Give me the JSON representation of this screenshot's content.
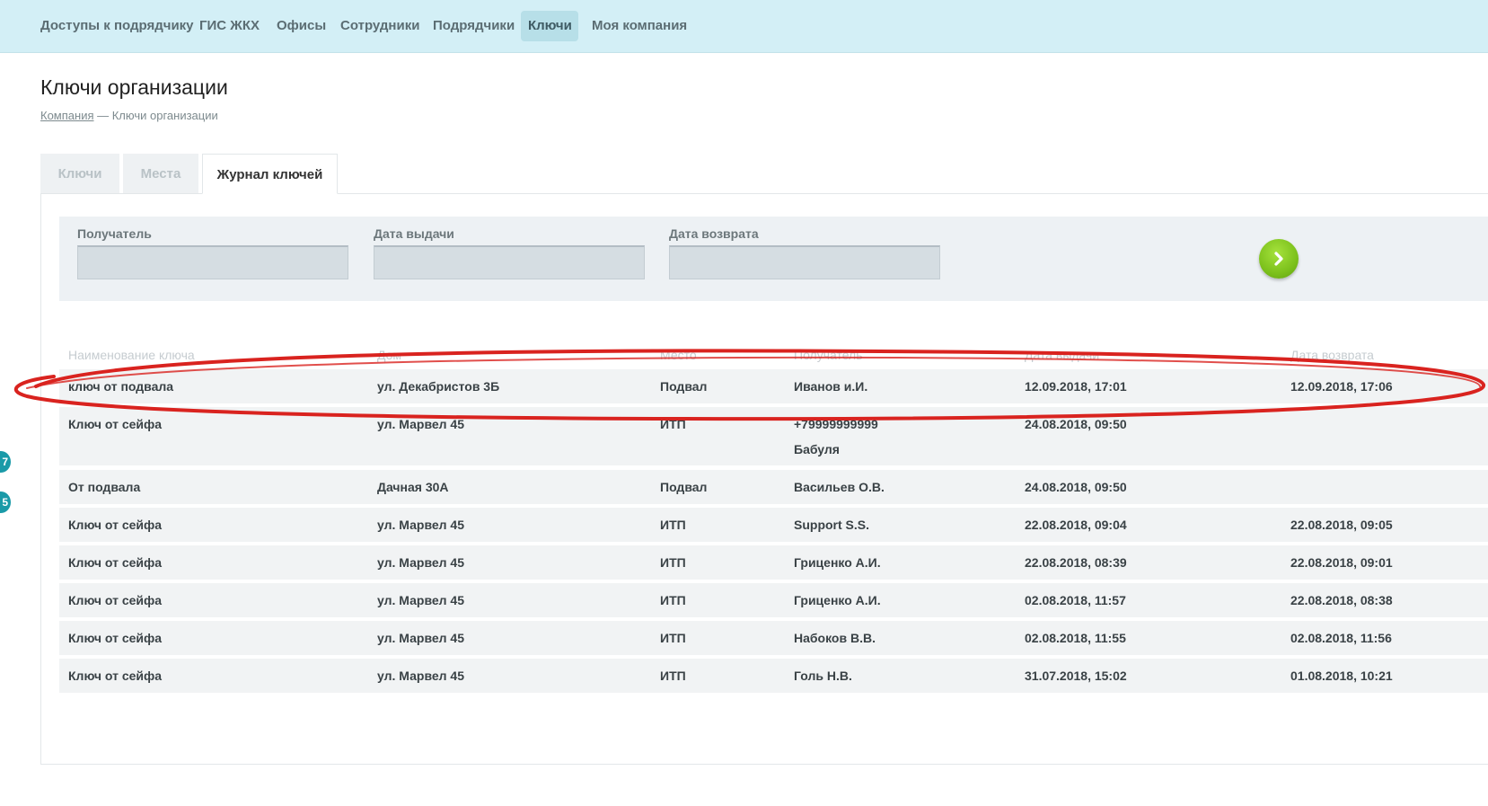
{
  "nav": {
    "items": [
      {
        "label": "Доступы к подрядчику"
      },
      {
        "label": "ГИС ЖКХ"
      },
      {
        "label": "Офисы"
      },
      {
        "label": "Сотрудники"
      },
      {
        "label": "Подрядчики"
      },
      {
        "label": "Ключи",
        "active": true
      },
      {
        "label": "Моя компания"
      }
    ]
  },
  "page": {
    "title": "Ключи организации",
    "breadcrumb": {
      "link": "Компания",
      "separator": " — ",
      "current": "Ключи организации"
    }
  },
  "tabs": [
    {
      "label": "Ключи"
    },
    {
      "label": "Места"
    },
    {
      "label": "Журнал ключей",
      "active": true
    }
  ],
  "filters": {
    "recipient_label": "Получатель",
    "issue_date_label": "Дата выдачи",
    "return_date_label": "Дата возврата",
    "recipient_value": "",
    "issue_date_value": "",
    "return_date_value": "",
    "submit_icon": "chevron-right-icon"
  },
  "table": {
    "headers": [
      "Наименование ключа",
      "Дом",
      "Место",
      "Получатель",
      "Дата выдачи",
      "Дата возврата"
    ],
    "rows": [
      {
        "name": "ключ от подвала",
        "house": "ул. Декабристов 3Б",
        "place": "Подвал",
        "recipient": "Иванов и.И.",
        "issued": "12.09.2018, 17:01",
        "returned": "12.09.2018, 17:06",
        "highlighted": true
      },
      {
        "name": "Ключ от сейфа",
        "house": "ул. Марвел 45",
        "place": "ИТП",
        "recipient": "+79999999999",
        "recipient_line2": "Бабуля",
        "issued": "24.08.2018, 09:50",
        "returned": ""
      },
      {
        "name": "От подвала",
        "house": "Дачная 30А",
        "place": "Подвал",
        "recipient": "Васильев О.В.",
        "issued": "24.08.2018, 09:50",
        "returned": ""
      },
      {
        "name": "Ключ от сейфа",
        "house": "ул. Марвел 45",
        "place": "ИТП",
        "recipient": "Support S.S.",
        "issued": "22.08.2018, 09:04",
        "returned": "22.08.2018, 09:05"
      },
      {
        "name": "Ключ от сейфа",
        "house": "ул. Марвел 45",
        "place": "ИТП",
        "recipient": "Гриценко А.И.",
        "issued": "22.08.2018, 08:39",
        "returned": "22.08.2018, 09:01"
      },
      {
        "name": "Ключ от сейфа",
        "house": "ул. Марвел 45",
        "place": "ИТП",
        "recipient": "Гриценко А.И.",
        "issued": "02.08.2018, 11:57",
        "returned": "22.08.2018, 08:38"
      },
      {
        "name": "Ключ от сейфа",
        "house": "ул. Марвел 45",
        "place": "ИТП",
        "recipient": "Набоков В.В.",
        "issued": "02.08.2018, 11:55",
        "returned": "02.08.2018, 11:56"
      },
      {
        "name": "Ключ от сейфа",
        "house": "ул. Марвел 45",
        "place": "ИТП",
        "recipient": "Голь Н.В.",
        "issued": "31.07.2018, 15:02",
        "returned": "01.08.2018, 10:21"
      }
    ]
  },
  "side_badges": [
    "7",
    "5"
  ],
  "colors": {
    "topbar": "#d3eff6",
    "highlight_ellipse": "#d9231f",
    "go_button": "#7cc11c",
    "badge": "#1a9aa8"
  }
}
